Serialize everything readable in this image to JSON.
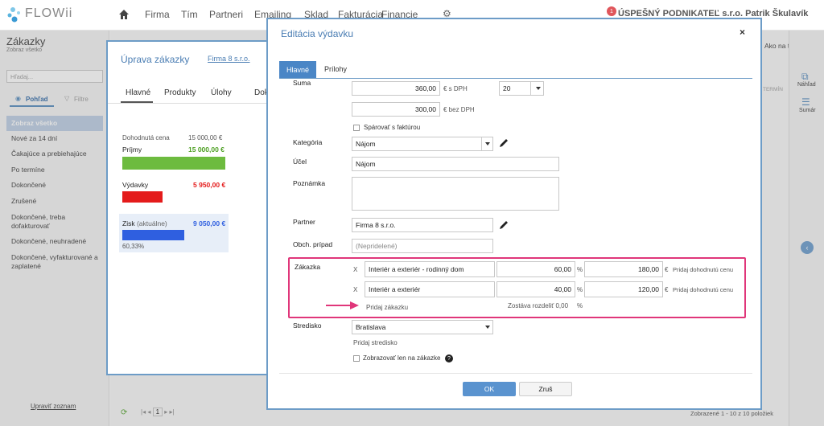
{
  "app": {
    "logo": "FLOWii",
    "company_user": "ÚSPEŠNÝ PODNIKATEĽ s.r.o. Patrik Škulavík",
    "notif_count": "1"
  },
  "nav": [
    "Firma",
    "Tím",
    "Partneri",
    "Emailing",
    "Sklad",
    "Fakturácia",
    "Financie"
  ],
  "sidebar": {
    "title": "Zákazky",
    "subtitle": "Zobraz všetko",
    "search_placeholder": "Hľadaj...",
    "view_tab": "Pohľad",
    "filter_tab": "Filtre",
    "items": [
      "Zobraz všetko",
      "Nové za 14 dní",
      "Čakajúce a prebiehajúce",
      "Po termíne",
      "Dokončené",
      "Zrušené",
      "Dokončené, treba dofakturovať",
      "Dokončené, neuhradené",
      "Dokončené, vyfakturované a zaplatené"
    ],
    "footer_link": "Upraviť zoznam"
  },
  "right": {
    "help": "Ako na to?",
    "preview": "Náhľad",
    "summary": "Sumár",
    "col_header": "TERMÍN",
    "footer": "Zobrazené 1 - 10 z 10 položiek",
    "page": "1"
  },
  "modal1": {
    "title": "Úprava zákazky",
    "partner_link": "Firma 8 s.r.o.",
    "tabs": [
      "Hlavné",
      "Produkty",
      "Úlohy",
      "Dok"
    ],
    "agreed_label": "Dohodnutá cena",
    "agreed_value": "15 000,00 €",
    "income_label": "Príjmy",
    "income_value": "15 000,00 €",
    "expense_label": "Výdavky",
    "expense_value": "5 950,00 €",
    "profit_label": "Zisk",
    "profit_note": "(aktuálne)",
    "profit_value": "9 050,00 €",
    "profit_pct": "60,33%",
    "colors": {
      "income": "#6dbb3f",
      "expense": "#e41b1b",
      "profit": "#2f5fe0"
    }
  },
  "modal2": {
    "title": "Editácia výdavku",
    "close": "×",
    "tabs": [
      "Hlavné",
      "Prílohy"
    ],
    "suma_label": "Suma",
    "suma_gross": "360,00",
    "gross_unit": "€ s DPH",
    "vat": "20",
    "suma_net": "300,00",
    "net_unit": "€ bez DPH",
    "pair_invoice": "Spárovať s faktúrou",
    "category_label": "Kategória",
    "category": "Nájom",
    "purpose_label": "Účel",
    "purpose": "Nájom",
    "note_label": "Poznámka",
    "partner_label": "Partner",
    "partner": "Firma 8 s.r.o.",
    "case_label": "Obch. prípad",
    "case_placeholder": "(Nepridelené)",
    "zakazka_label": "Zákazka",
    "zakazky": [
      {
        "x": "X",
        "name": "Interiér a exteriér - rodinný dom",
        "pct": "60,00",
        "pct_unit": "%",
        "amount": "180,00",
        "cur": "€",
        "add_price": "Pridaj dohodnutú cenu"
      },
      {
        "x": "X",
        "name": "Interiér a exteriér",
        "pct": "40,00",
        "pct_unit": "%",
        "amount": "120,00",
        "cur": "€",
        "add_price": "Pridaj dohodnutú cenu"
      }
    ],
    "add_zakazka": "Pridaj zákazku",
    "remaining": "Zostáva rozdeliť 0,00",
    "remaining_unit": "%",
    "center_label": "Stredisko",
    "center": "Bratislava",
    "add_center": "Pridaj stredisko",
    "show_only": "Zobrazovať len na zákazke",
    "ok": "OK",
    "cancel": "Zruš",
    "highlight_color": "#e0367a"
  }
}
